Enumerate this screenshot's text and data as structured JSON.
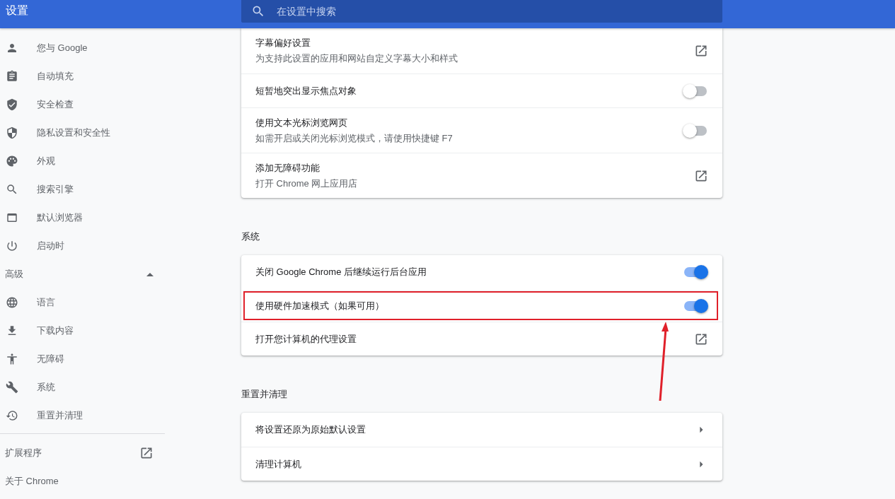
{
  "header": {
    "title": "设置",
    "search": {
      "placeholder": "在设置中搜索"
    }
  },
  "sidebar": {
    "items": [
      {
        "label": "您与 Google"
      },
      {
        "label": "自动填充"
      },
      {
        "label": "安全检查"
      },
      {
        "label": "隐私设置和安全性"
      },
      {
        "label": "外观"
      },
      {
        "label": "搜索引擎"
      },
      {
        "label": "默认浏览器"
      },
      {
        "label": "启动时"
      }
    ],
    "advanced": {
      "label": "高级",
      "expanded": true,
      "items": [
        {
          "label": "语言"
        },
        {
          "label": "下载内容"
        },
        {
          "label": "无障碍"
        },
        {
          "label": "系统"
        },
        {
          "label": "重置并清理"
        }
      ]
    },
    "links": [
      {
        "label": "扩展程序",
        "external": true
      },
      {
        "label": "关于 Chrome",
        "external": false
      }
    ]
  },
  "sections": [
    {
      "rows": [
        {
          "kind": "link",
          "title": "字幕偏好设置",
          "subtitle": "为支持此设置的应用和网站自定义字幕大小和样式"
        },
        {
          "kind": "toggle",
          "title": "短暂地突出显示焦点对象",
          "on": false
        },
        {
          "kind": "toggle",
          "title": "使用文本光标浏览网页",
          "subtitle": "如需开启或关闭光标浏览模式，请使用快捷键 F7",
          "on": false
        },
        {
          "kind": "link",
          "title": "添加无障碍功能",
          "subtitle": "打开 Chrome 网上应用店"
        }
      ]
    },
    {
      "title": "系统",
      "rows": [
        {
          "kind": "toggle",
          "title": "关闭 Google Chrome 后继续运行后台应用",
          "on": true
        },
        {
          "kind": "toggle",
          "title": "使用硬件加速模式（如果可用）",
          "on": true,
          "highlighted": true
        },
        {
          "kind": "link",
          "title": "打开您计算机的代理设置"
        }
      ]
    },
    {
      "title": "重置并清理",
      "rows": [
        {
          "kind": "arrow",
          "title": "将设置还原为原始默认设置"
        },
        {
          "kind": "arrow",
          "title": "清理计算机"
        }
      ]
    }
  ]
}
